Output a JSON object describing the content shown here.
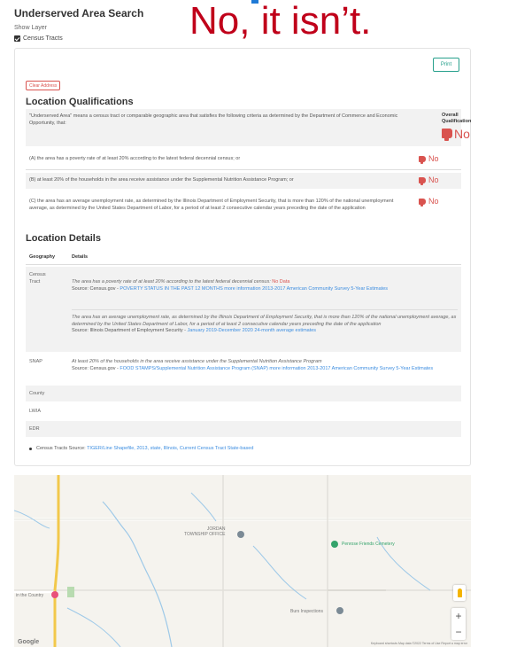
{
  "header": {
    "title": "Underserved Area Search",
    "show_layer": "Show Layer",
    "layer_label": "Census Tracts"
  },
  "overlay_text": "No, it isn’t.",
  "buttons": {
    "print": "Print",
    "clear_address": "Clear Address"
  },
  "qualifications": {
    "heading": "Location Qualifications",
    "intro": "\"Underserved Area\" means a census tract or comparable geographic area that satisfies the following criteria as determined by the Department of Commerce and Economic Opportunity, that:",
    "overall_label": "Overall Qualification",
    "overall_value": "No",
    "criteria": [
      {
        "text": "(A) the area has a poverty rate of at least 20% according to the latest federal decennial census; or",
        "result": "No"
      },
      {
        "text": "(B) at least 20% of the households in the area receive assistance under the Supplemental Nutrition Assistance Program; or",
        "result": "No"
      },
      {
        "text": "(C) the area has an average unemployment rate, as determined by the Illinois Department of Employment Security, that is more than 120% of the national unemployment average, as determined by the United States Department of Labor, for a period of at least 2 consecutive calendar years preceding the date of the application",
        "result": "No"
      }
    ]
  },
  "details": {
    "heading": "Location Details",
    "col_geography": "Geography",
    "col_details": "Details",
    "census": {
      "geo_line1": "Census",
      "geo_line2": "Tract",
      "poverty_statement": "The area has a poverty rate of at least 20% according to the latest federal decennial census:",
      "poverty_value": "No Data",
      "poverty_source_prefix": "Source: Census.gov - ",
      "poverty_source_link": "POVERTY STATUS IN THE PAST 12 MONTHS more information 2013-2017 American Community Survey 5-Year Estimates",
      "unemp_statement": "The area has an average unemployment rate, as determined by the Illinois Department of Employment Security, that is more than 120% of the national unemployment average, as determined by the United States Department of Labor, for a period of at least 2 consecutive calendar years preceding the date of the application",
      "unemp_source_prefix": "Source: Illinois Department of Employment Security - ",
      "unemp_source_link": "January 2019-December 2020 24-month average estimates"
    },
    "snap": {
      "geo": "SNAP",
      "statement": "At least 20% of the households in the area receive assistance under the Supplemental Nutrition Assistance Program",
      "source_prefix": "Source: Census.gov - ",
      "source_link": "FOOD STAMPS/Supplemental Nutrition Assistance Program (SNAP) more information 2013-2017 American Community Survey 5-Year Estimates"
    },
    "county": "County",
    "lwia": "LWIA",
    "edr": "EDR",
    "tracts_source_prefix": "Census Tracts Source: ",
    "tracts_source_link": "TIGER/Line Shapefile, 2013, state, Illinois, Current Census Tract State-based"
  },
  "map": {
    "labels": {
      "township_line1": "JORDAN",
      "township_line2": "TOWNSHIP OFFICE",
      "cemetery": "Penrose Friends Cemetery",
      "country": "in the Country",
      "inspections": "Burs Inspections"
    },
    "zoom_in": "+",
    "zoom_out": "−",
    "google": "Google",
    "attribution": "Keyboard shortcuts   Map data ©2022   Terms of Use   Report a map error",
    "colors": {
      "road_yellow": "#f2c84b",
      "road_white": "#ffffff",
      "water": "#9ec9e8",
      "pin_green": "#34a36b",
      "pin_red": "#e8507a",
      "pin_gray": "#7b8a95"
    }
  }
}
